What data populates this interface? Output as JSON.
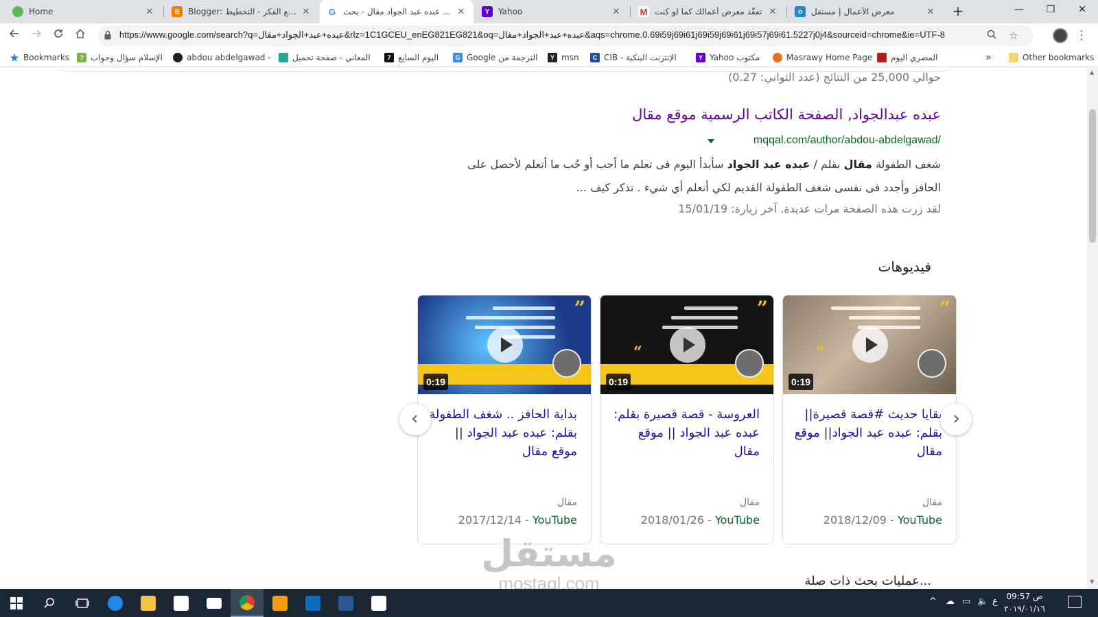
{
  "browser": {
    "tabs": [
      {
        "title": "Home",
        "icon": "home-app-icon",
        "color": "#5cb85c"
      },
      {
        "title": "Blogger: روائع الفكر - التخطيط",
        "icon": "blogger-icon",
        "color": "#f57d00"
      },
      {
        "title": "عبده عبد الجواد مقال - بحث Google",
        "icon": "google-icon",
        "color": "#4285f4"
      },
      {
        "title": "Yahoo",
        "icon": "yahoo-icon",
        "color": "#6001d2"
      },
      {
        "title": "تفقّد معرض أعمالك كما لو كنت",
        "icon": "gmail-icon",
        "color": "#d93025"
      },
      {
        "title": "معرض الأعمال | مستقل",
        "icon": "mostaql-icon",
        "color": "#2386c8"
      }
    ],
    "new_tab": "+",
    "window_controls": {
      "minimize": "—",
      "maximize": "❐",
      "close": "✕"
    },
    "url": "https://www.google.com/search?q=عبده+عبد+الجواد+مقال&rlz=1C1GCEU_enEG821EG821&oq=عبده+عبد+الجواد+مقال&aqs=chrome.0.69i59j69i61j69i59j69i61j69i57j69i61.5227j0j4&sourceid=chrome&ie=UTF-8",
    "bookmarks": [
      {
        "label": "Bookmarks",
        "color": "#1a73e8",
        "icon": "star-icon"
      },
      {
        "label": "الإسلام سؤال وجواب",
        "color": "#7cb342",
        "icon": "islamqa-icon"
      },
      {
        "label": "abdou abdelgawad -",
        "color": "#202124",
        "icon": "cloud-icon"
      },
      {
        "label": "المعاني - صفحة تحميل",
        "color": "#26a69a",
        "icon": "almaany-icon"
      },
      {
        "label": "اليوم السابع",
        "color": "#111111",
        "icon": "youm7-icon"
      },
      {
        "label": "Google الترجمة من",
        "color": "#4285f4",
        "icon": "translate-icon"
      },
      {
        "label": "msn",
        "color": "#222222",
        "icon": "msn-icon"
      },
      {
        "label": "CIB - الإنترنت البنكية",
        "color": "#1f4e9c",
        "icon": "cib-icon"
      },
      {
        "label": "Yahoo مكتوب",
        "color": "#6001d2",
        "icon": "yahoo-icon"
      },
      {
        "label": "Masrawy Home Page",
        "color": "#e8711c",
        "icon": "masrawy-icon"
      },
      {
        "label": "المصري اليوم",
        "color": "#b71c1c",
        "icon": "almasryalyoum-icon"
      }
    ],
    "bookmarks_overflow": "»",
    "other_bookmarks": "Other bookmarks"
  },
  "search": {
    "stats": "حوالي 25,000 من النتائج (عدد الثواني: 0.27)",
    "result": {
      "title": "عبده عبدالجواد, الصفحة الكاتب الرسمية موقع مقال",
      "url": "mqqal.com/author/abdou-abdelgawad/",
      "snippet_bold_1": "مقال",
      "snippet_pre": "شغف الطفولة ",
      "snippet_mid": " بقلم / ",
      "snippet_bold_2": "عبده عبد الجواد",
      "snippet_post": " سأبدأ اليوم فى تعلم ما أحب أو حُب ما أتعلم لأحصل على الحافز وأجدد فى نفسى شغف الطفولة القديم لكي أتعلم أي شيء . تذكر كيف ...",
      "visited": "لقد زرت هذه الصفحة مرات عديدة. آخر زيارة: 15/01/19"
    },
    "videos_heading": "فيديوهات",
    "videos": [
      {
        "title": "بقايا حديث #قصة قصيرة|| بقلم: عبده عبد الجواد|| موقع مقال",
        "source": "مقال",
        "platform": "YouTube",
        "date": "2018/12/09",
        "duration": "0:19"
      },
      {
        "title": "العروسة - قصة قصيرة بقلم: عبده عبد الجواد || موقع مقال",
        "source": "مقال",
        "platform": "YouTube",
        "date": "2018/01/26",
        "duration": "0:19"
      },
      {
        "title": "بداية الحافز .. شغف الطفولة بقلم: عبده عبد الجواد || موقع مقال",
        "source": "مقال",
        "platform": "YouTube",
        "date": "2017/12/14",
        "duration": "0:19"
      }
    ],
    "below_peek": "...عمليات بحث ذات صلة"
  },
  "watermark": {
    "arabic": "مستقل",
    "latin": "mostaql.com"
  },
  "taskbar": {
    "apps": [
      {
        "name": "start",
        "color": "#ffffff"
      },
      {
        "name": "search",
        "color": "#ffffff"
      },
      {
        "name": "task-view",
        "color": "#ffffff"
      },
      {
        "name": "edge",
        "color": "#1e88e5"
      },
      {
        "name": "file-explorer",
        "color": "#f4c542"
      },
      {
        "name": "store",
        "color": "#ffffff"
      },
      {
        "name": "mail",
        "color": "#ffffff"
      },
      {
        "name": "chrome",
        "color": "#db4437"
      },
      {
        "name": "media-player",
        "color": "#f39c12"
      },
      {
        "name": "outlook",
        "color": "#0f6cbd"
      },
      {
        "name": "word",
        "color": "#2b579a"
      },
      {
        "name": "photos",
        "color": "#ffffff"
      }
    ],
    "lang": "ع",
    "time": "09:57 ص",
    "date": "٢٠١٩/٠١/١٦"
  }
}
